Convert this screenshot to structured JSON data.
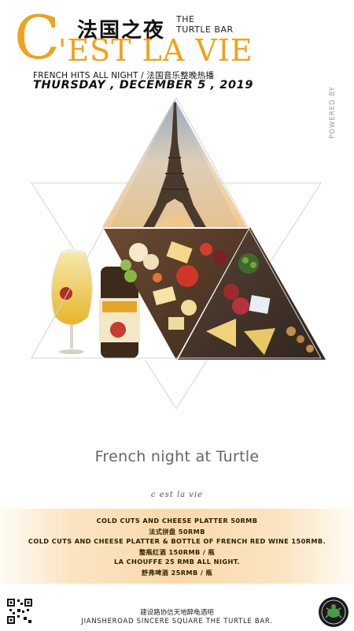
{
  "header": {
    "title_cn": "法国之夜",
    "turtle_bar": [
      "THE",
      "TURTLE BAR"
    ],
    "big_letter": "C",
    "title_main": "'EST LA VIE",
    "subline": "FRENCH HITS ALL NIGHT / 法国音乐整晚热播",
    "date": "THURSDAY , DECEMBER 5 , 2019",
    "powered_by": "POWERED BY"
  },
  "tagline": "French night at Turtle",
  "script_line": "c est la vie",
  "menu": [
    "COLD CUTS AND CHEESE PLATTER 50RMB",
    "法式拼盘 50RMB",
    "COLD CUTS AND CHEESE PLATTER & BOTTLE OF FRENCH RED WINE 150RMB.",
    "整瓶红酒 150RMB / 瓶",
    "LA CHOUFFE 25 RMB ALL NIGHT.",
    "舒弗啤酒 25RMB / 瓶"
  ],
  "footer": {
    "address_cn": "建设路协信天地醉龟酒吧",
    "address_en": "JIANSHEROAD SINCERE SQUARE THE TURTLE BAR."
  },
  "colors": {
    "accent": "#f0a21a",
    "band": "#fad9ab"
  },
  "icons": {
    "qr": "qr-code-icon",
    "logo": "turtle-bar-logo-icon"
  }
}
